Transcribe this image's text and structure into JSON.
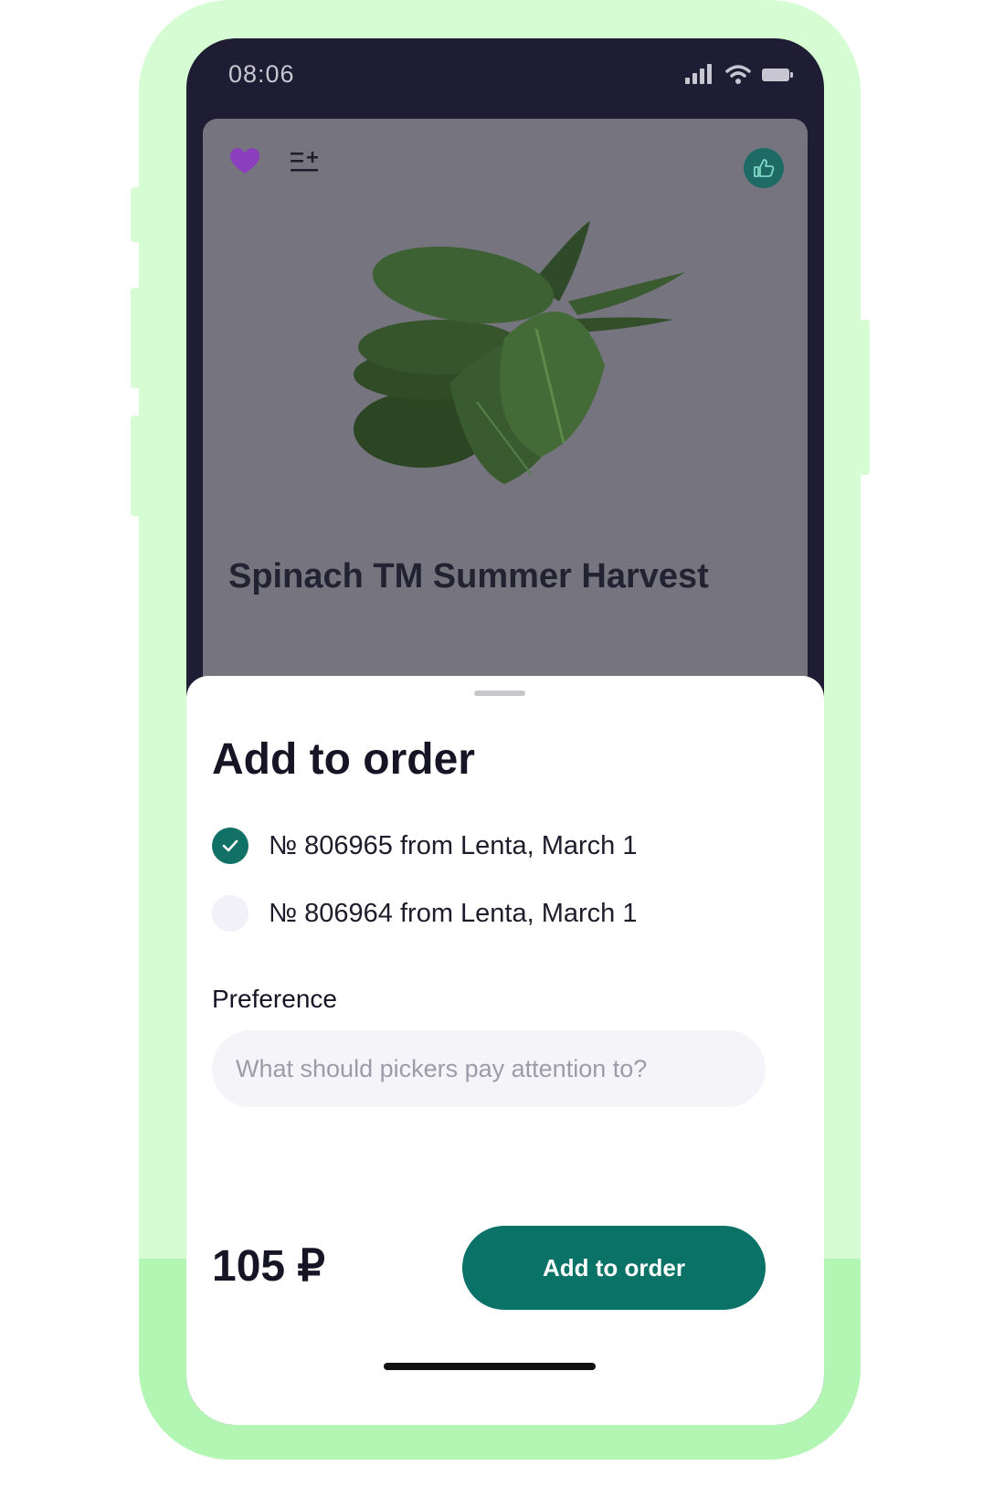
{
  "status_bar": {
    "time": "08:06"
  },
  "product": {
    "title": "Spinach TM Summer Harvest",
    "favorite_icon": "heart-icon",
    "add_to_list_icon": "list-add-icon",
    "share_icon": "thumbs-up-icon"
  },
  "sheet": {
    "title": "Add to order",
    "orders": [
      {
        "label": "№ 806965 from Lenta, March 1",
        "selected": true
      },
      {
        "label": "№ 806964 from Lenta, March 1",
        "selected": false
      }
    ],
    "preference": {
      "label": "Preference",
      "value": "",
      "placeholder": "What should pickers pay attention to?"
    },
    "price": "105 ₽",
    "cta_label": "Add to order"
  },
  "colors": {
    "accent": "#0b7267",
    "favorite": "#8b3fbd",
    "shell": "#d6fcd3",
    "screen_bg": "#1f1d33"
  }
}
